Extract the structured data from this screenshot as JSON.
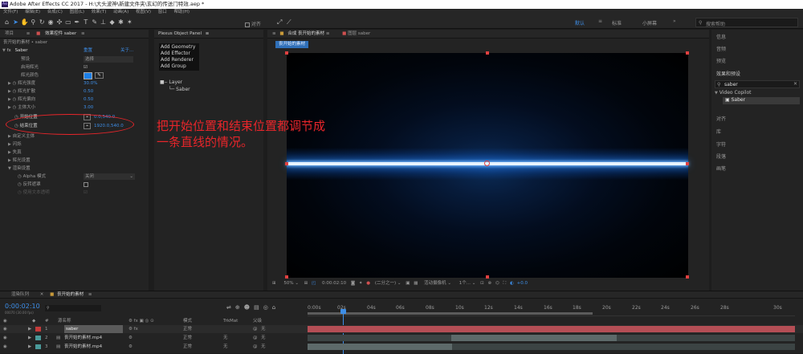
{
  "title": "Adobe After Effects CC 2017 - H:\\大头波神\\新建文件夹\\玄幻的传送门特效.aep *",
  "menu": [
    "文件(F)",
    "编辑(E)",
    "合成(C)",
    "图层(L)",
    "效果(T)",
    "动画(A)",
    "视图(V)",
    "窗口",
    "帮助(H)"
  ],
  "toolbar": {
    "snap_label": "对齐",
    "workspace_default": "默认",
    "workspace_standard": "标准",
    "workspace_small": "小屏幕",
    "search_placeholder": "搜索帮助"
  },
  "left_panel": {
    "tab_project": "项目",
    "tab_effects": "效果控件 saber",
    "comp_path": "丧开始的素材 • saber",
    "fx_name": "Saber",
    "reset": "重置",
    "about": "关于...",
    "rows": [
      {
        "label": "预设",
        "value": "选择"
      },
      {
        "label": "启用辉光",
        "value": ""
      },
      {
        "label": "辉光颜色",
        "value": ""
      },
      {
        "label": "辉光强度",
        "value": "30.0%"
      },
      {
        "label": "辉光扩散",
        "value": "0.50"
      },
      {
        "label": "辉光偏向",
        "value": "0.50"
      },
      {
        "label": "主体大小",
        "value": "3.00"
      },
      {
        "label": "开始位置",
        "value": "0.0,540.0"
      },
      {
        "label": "结束位置",
        "value": "1920.0,540.0"
      }
    ],
    "groups": [
      "自定义主体",
      "闪烁",
      "失真",
      "辉光设置",
      "渲染设置"
    ],
    "alpha_label": "Alpha 模式",
    "alpha_value": "关闭",
    "invert_label": "反转遮罩",
    "text_alpha_label": "使用文本透明"
  },
  "plexus": {
    "title": "Plexus Object Panel",
    "items": [
      "Add Geometry",
      "Add Effector",
      "Add Renderer",
      "Add Group"
    ],
    "layer": "Layer",
    "child": "Saber"
  },
  "comp_panel": {
    "tab1": "合成 丧开始的素材",
    "tab2": "图层 saber",
    "sub_tab": "丧开始的素材",
    "zoom": "50%",
    "time": "0:00:02:10",
    "quality": "(二分之一)",
    "camera": "活动摄像机",
    "views": "1个...",
    "exposure": "+0.0"
  },
  "annotation": {
    "line1": "把开始位置和结束位置都调节成",
    "line2": "一条直线的情况。",
    "color": "#e8252a"
  },
  "right_panel": {
    "items_top": [
      "信息",
      "音频",
      "预览",
      "效果和预设"
    ],
    "search_value": "saber",
    "category": "Video Copilot",
    "effect": "Saber",
    "items_bottom": [
      "对齐",
      "库",
      "字符",
      "段落",
      "画笔"
    ]
  },
  "timeline": {
    "tab_render": "渲染队列",
    "tab_comp": "丧开始的素材",
    "timecode": "0:00:02:10",
    "frame_info": "00070 (30.00 fps)",
    "col_source": "源名称",
    "col_mode": "模式",
    "col_trkmat": "TrkMat",
    "col_parent": "父级",
    "ruler": [
      "0:00s",
      "02s",
      "04s",
      "06s",
      "08s",
      "10s",
      "12s",
      "14s",
      "16s",
      "18s",
      "20s",
      "22s",
      "24s",
      "26s",
      "28s",
      "30s"
    ],
    "layers": [
      {
        "num": "1",
        "name": "saber",
        "mode": "正常",
        "trk": "",
        "parent": "无",
        "color": "#c43b3b"
      },
      {
        "num": "2",
        "name": "丧开始的素材.mp4",
        "mode": "正常",
        "trk": "无",
        "parent": "无",
        "color": "#4a9a9a"
      },
      {
        "num": "3",
        "name": "丧开始的素材.mp4",
        "mode": "正常",
        "trk": "无",
        "parent": "无",
        "color": "#4a9a9a"
      }
    ]
  },
  "colors": {
    "accent": "#2f8be0",
    "red_bar": "#b44e55",
    "annotation": "#e8252a"
  }
}
